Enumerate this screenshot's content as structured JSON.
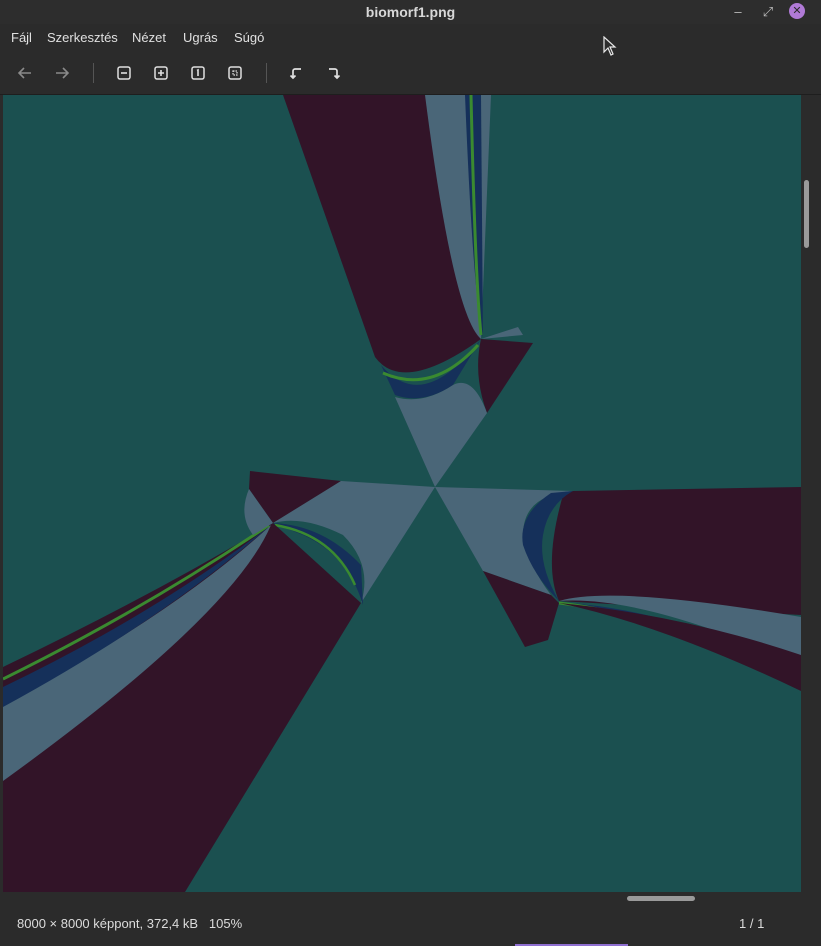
{
  "window": {
    "title": "biomorf1.png"
  },
  "menu": {
    "items": [
      "Fájl",
      "Szerkesztés",
      "Nézet",
      "Ugrás",
      "Súgó"
    ]
  },
  "toolbar": {
    "buttons": [
      "back-arrow-icon",
      "forward-arrow-icon",
      "zoom-out-icon",
      "zoom-in-icon",
      "zoom-original-icon",
      "zoom-fit-icon",
      "rotate-left-icon",
      "rotate-right-icon"
    ]
  },
  "colors": {
    "background_teal": "#1b5050",
    "maroon": "#321428",
    "slate": "#4a6678",
    "navy": "#15305a",
    "green": "#3a8a30",
    "accent": "#b07ad6"
  },
  "status": {
    "info": "8000 × 8000 képpont, 372,4 kB   105%",
    "page": "1 / 1"
  }
}
